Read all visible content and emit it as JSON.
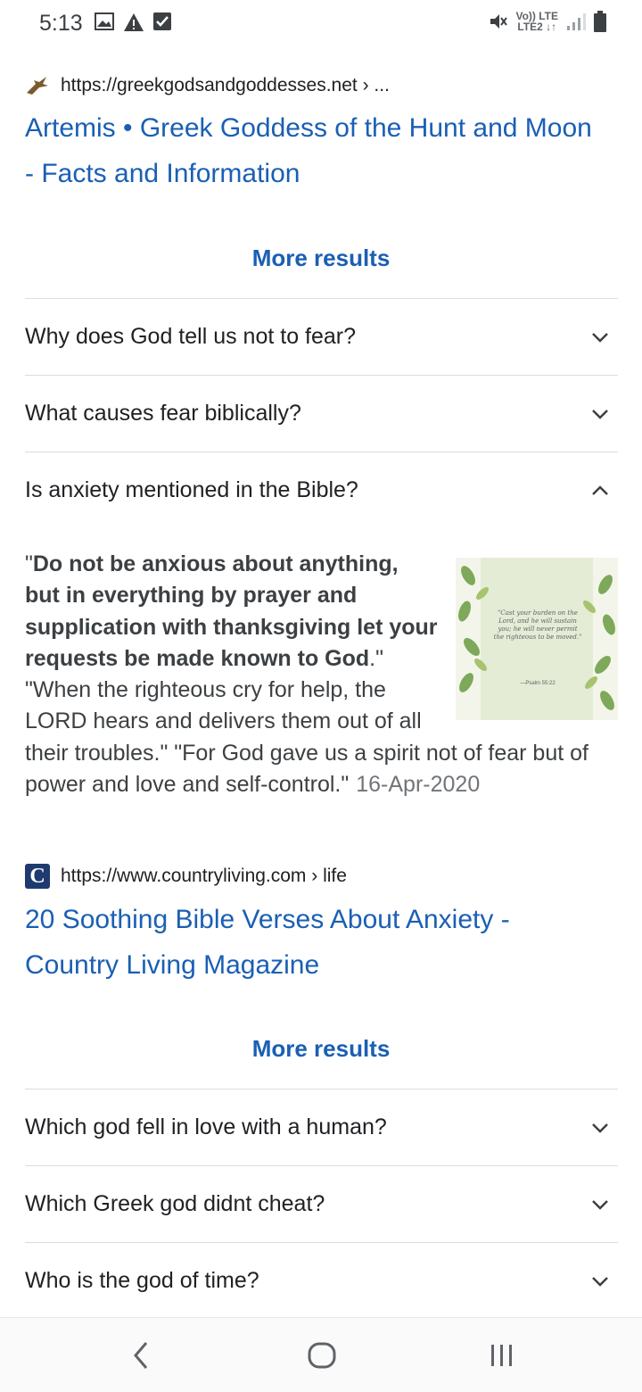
{
  "status_bar": {
    "time": "5:13",
    "network_top": "Vo)) LTE",
    "network_bottom": "LTE2 ↓↑",
    "icons": [
      "image-icon",
      "warning-icon",
      "check-box-icon",
      "mute-icon",
      "signal-icon",
      "battery-icon"
    ]
  },
  "result1": {
    "url": "https://greekgodsandgoddesses.net › ...",
    "title": "Artemis • Greek Goddess of the Hunt and Moon - Facts and Information",
    "more": "More results"
  },
  "faq1": [
    {
      "question": "Why does God tell us not to fear?",
      "expanded": false
    },
    {
      "question": "What causes fear biblically?",
      "expanded": false
    },
    {
      "question": "Is anxiety mentioned in the Bible?",
      "expanded": true
    }
  ],
  "answer": {
    "quote_open": "\"",
    "bold": "Do not be anxious about anything, but in everything by prayer and supplication with thanksgiving let your requests be made known to God",
    "rest": ".\" \"When the righteous cry for help, the LORD hears and delivers them out of all their troubles.\" \"For God gave us a spirit not of fear but of power and love and self-control.\"",
    "date": "16-Apr-2020",
    "image_text": "\"Cast your burden on the Lord, and he will sustain you; he will never permit the righteous to be moved.\"",
    "image_ref": "—Psalm 55:22"
  },
  "result2": {
    "favicon_letter": "C",
    "url": "https://www.countryliving.com › life",
    "title": "20 Soothing Bible Verses About Anxiety - Country Living Magazine",
    "more": "More results"
  },
  "faq2": [
    {
      "question": "Which god fell in love with a human?",
      "expanded": false
    },
    {
      "question": "Which Greek god didnt cheat?",
      "expanded": false
    },
    {
      "question": "Who is the god of time?",
      "expanded": false
    }
  ],
  "colors": {
    "link": "#1a5fb4",
    "text": "#202124",
    "divider": "#dadce0"
  }
}
